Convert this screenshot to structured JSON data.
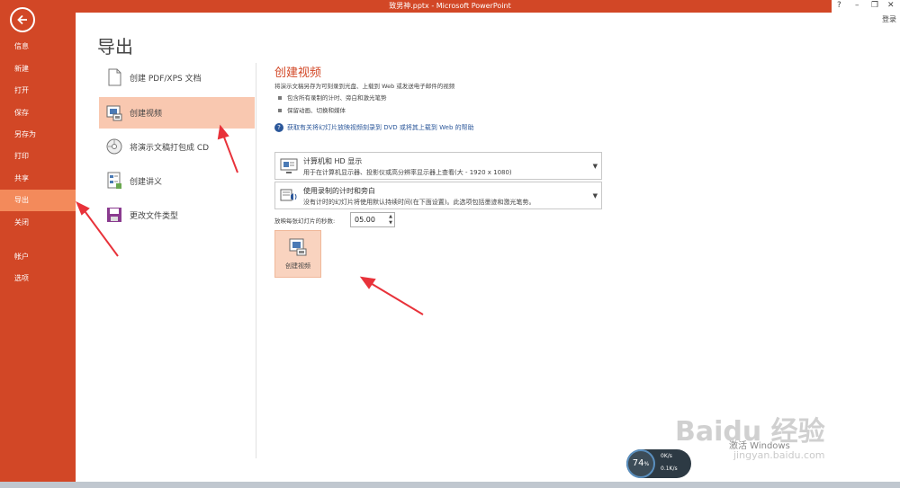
{
  "window": {
    "title": "致男神.pptx - Microsoft PowerPoint",
    "help": "?",
    "minimize": "–",
    "restore": "❐",
    "close": "✕",
    "login": "登录"
  },
  "nav": {
    "items": [
      {
        "label": "信息"
      },
      {
        "label": "新建"
      },
      {
        "label": "打开"
      },
      {
        "label": "保存"
      },
      {
        "label": "另存为"
      },
      {
        "label": "打印"
      },
      {
        "label": "共享"
      },
      {
        "label": "导出",
        "active": true
      },
      {
        "label": "关闭"
      },
      {
        "label": "帐户"
      },
      {
        "label": "选项"
      }
    ]
  },
  "page_title": "导出",
  "export_options": [
    {
      "label": "创建 PDF/XPS 文档",
      "icon": "pdf-icon"
    },
    {
      "label": "创建视频",
      "icon": "video-icon",
      "active": true
    },
    {
      "label": "将演示文稿打包成 CD",
      "icon": "cd-icon"
    },
    {
      "label": "创建讲义",
      "icon": "handout-icon"
    },
    {
      "label": "更改文件类型",
      "icon": "filetype-icon"
    }
  ],
  "panel": {
    "title": "创建视频",
    "description": "将演示文稿另存为可刻录到光盘、上载到 Web 或发送电子邮件的视频",
    "bullets": [
      "包含所有录制的计时、旁白和激光笔势",
      "保留动画、切换和媒体"
    ],
    "help_link": "获取有关将幻灯片放映视频刻录到 DVD 或将其上载到 Web 的帮助",
    "quality_dropdown": {
      "title": "计算机和 HD 显示",
      "subtitle": "用于在计算机显示器、投影仪或高分辨率显示器上查看(大 - 1920 x 1080)"
    },
    "timing_dropdown": {
      "title": "使用录制的计时和旁白",
      "subtitle": "没有计时的幻灯片将使用默认持续时间(在下面设置)。此选项包括墨迹和激光笔势。"
    },
    "seconds_label": "放映每张幻灯片的秒数:",
    "seconds_value": "05.00",
    "create_button": "创建视频"
  },
  "overlay": {
    "net_percent": "74",
    "net_percent_unit": "%",
    "upload": "0K/s",
    "download": "0.1K/s",
    "activate_text": "激活 Windows",
    "watermark": "Baidu 经验",
    "watermark_url": "jingyan.baidu.com"
  },
  "colors": {
    "accent": "#d24726",
    "active_nav": "#f38a5b",
    "active_item": "#f9c8b0",
    "annotation_arrow": "#e8323a"
  }
}
